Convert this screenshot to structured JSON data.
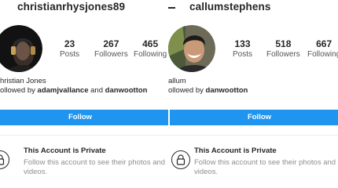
{
  "left_profile": {
    "username": "christianrhysjones89",
    "stats": [
      {
        "value": "23",
        "label": "Posts"
      },
      {
        "value": "267",
        "label": "Followers"
      },
      {
        "value": "465",
        "label": "Following"
      }
    ],
    "display_name": "hristian Jones",
    "followed_by_prefix": "ollowed by ",
    "followed_by_user1": "adamjvallance",
    "followed_by_and": " and ",
    "followed_by_user2": "danwootton",
    "follow_button": "Follow",
    "private_title": "This Account is Private",
    "private_desc": "Follow this account to see their photos and videos."
  },
  "right_profile": {
    "username": "callumstephens",
    "stats": [
      {
        "value": "133",
        "label": "Posts"
      },
      {
        "value": "518",
        "label": "Followers"
      },
      {
        "value": "667",
        "label": "Following"
      }
    ],
    "display_name": "allum",
    "followed_by_prefix": "ollowed by ",
    "followed_by_user1": "danwootton",
    "follow_button": "Follow",
    "private_title": "This Account is Private",
    "private_desc": "Follow this account to see their photos and videos."
  },
  "colors": {
    "accent": "#1f95f0",
    "text": "#262626",
    "muted": "#8e8e8e"
  },
  "icons": {
    "lock": "lock-icon",
    "back": "back-arrow-icon"
  }
}
